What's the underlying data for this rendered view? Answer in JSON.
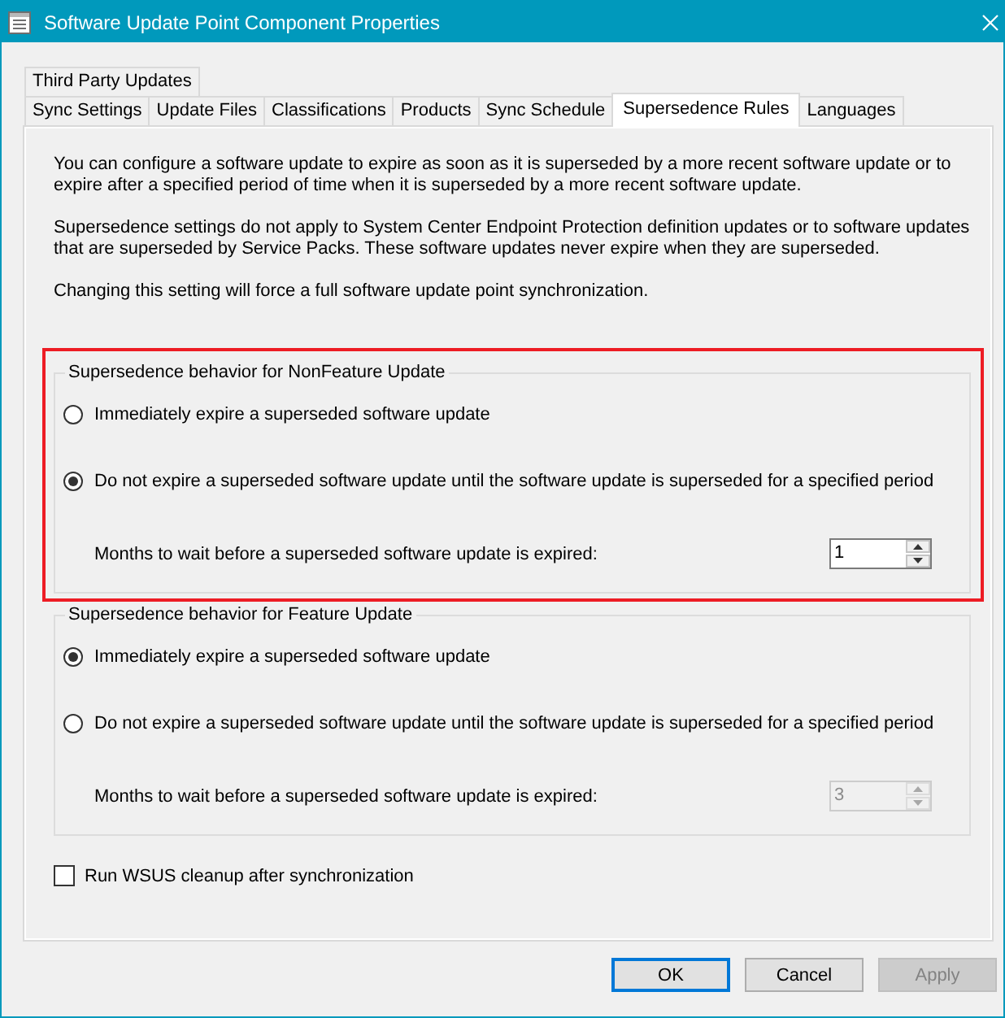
{
  "window": {
    "title": "Software Update Point Component Properties"
  },
  "tab_rows": [
    [
      {
        "label": "Third Party Updates",
        "selected": false
      }
    ],
    [
      {
        "label": "Sync Settings",
        "selected": false
      },
      {
        "label": "Update Files",
        "selected": false
      },
      {
        "label": "Classifications",
        "selected": false
      },
      {
        "label": "Products",
        "selected": false
      },
      {
        "label": "Sync Schedule",
        "selected": false
      },
      {
        "label": "Supersedence Rules",
        "selected": true
      },
      {
        "label": "Languages",
        "selected": false
      }
    ]
  ],
  "intro": [
    "You can configure a software update to expire as soon as it is superseded by a more recent software update or to expire after a specified period of time when it is superseded by a more recent software update.",
    "Supersedence settings do not apply to System Center Endpoint Protection definition updates or to software updates that are superseded by Service Packs. These software updates never expire when they are superseded.",
    "Changing this setting will force a full software update point synchronization."
  ],
  "groups": [
    {
      "title": "Supersedence behavior for NonFeature Update",
      "highlighted": true,
      "options": [
        {
          "label": "Immediately expire a superseded software update",
          "selected": false
        },
        {
          "label": "Do not expire a superseded software update until the software update is superseded for a specified period",
          "selected": true
        }
      ],
      "months": {
        "label": "Months to wait before a superseded software update is expired:",
        "value": "1",
        "disabled": false
      }
    },
    {
      "title": "Supersedence behavior for Feature Update",
      "highlighted": false,
      "options": [
        {
          "label": "Immediately expire a superseded software update",
          "selected": true
        },
        {
          "label": "Do not expire a superseded software update until the software update is superseded for a specified period",
          "selected": false
        }
      ],
      "months": {
        "label": "Months to wait before a superseded software update is expired:",
        "value": "3",
        "disabled": true
      }
    }
  ],
  "cleanup": {
    "label": "Run WSUS cleanup after synchronization",
    "checked": false
  },
  "buttons": [
    {
      "label": "OK",
      "focused": true,
      "disabled": false
    },
    {
      "label": "Cancel",
      "focused": false,
      "disabled": false
    },
    {
      "label": "Apply",
      "focused": false,
      "disabled": true
    }
  ]
}
